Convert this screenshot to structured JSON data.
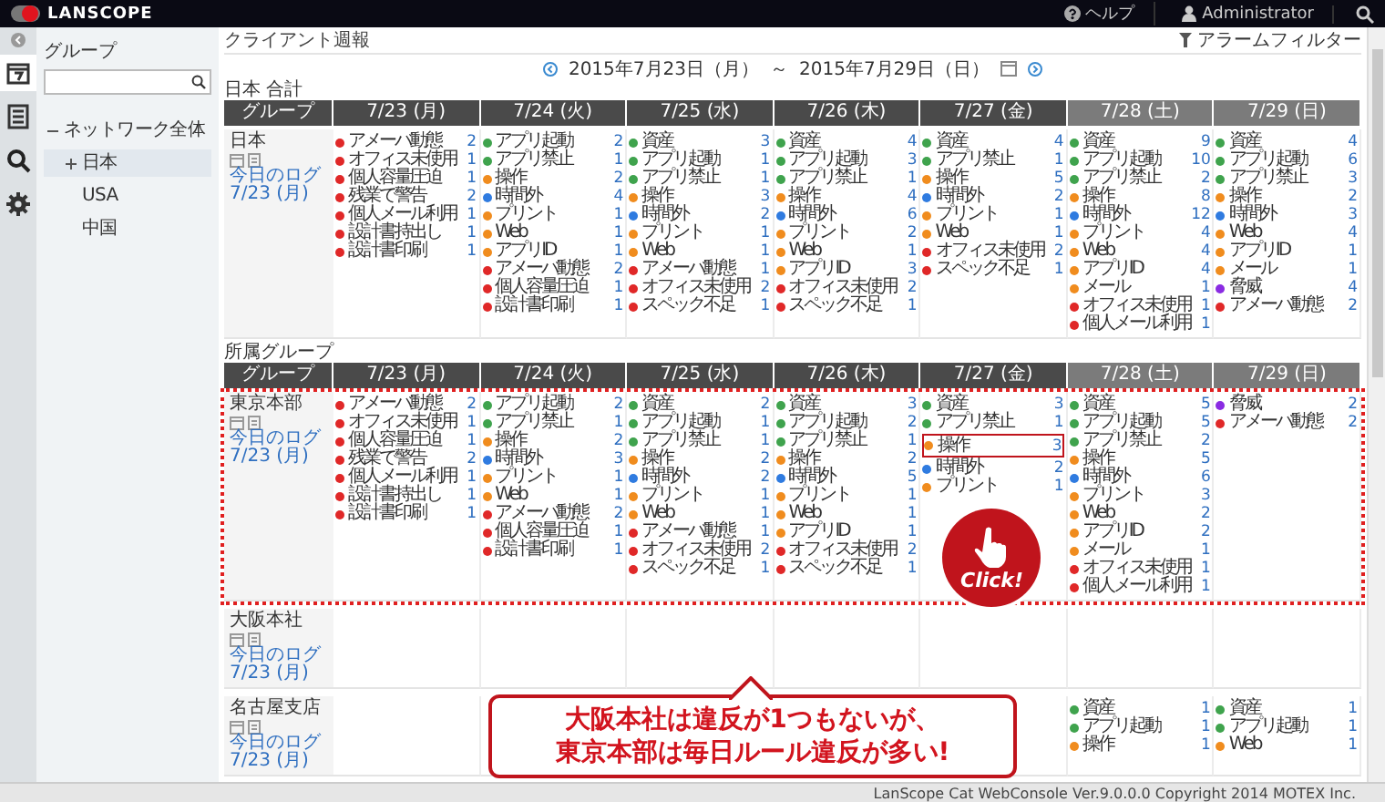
{
  "header": {
    "logo": "LANSCOPE",
    "help": "ヘルプ",
    "user": "Administrator"
  },
  "nav": [
    {
      "kind": "calendar",
      "selected": true
    },
    {
      "kind": "report",
      "selected": false
    },
    {
      "kind": "search",
      "selected": false
    },
    {
      "kind": "settings",
      "selected": false
    }
  ],
  "tree": {
    "title": "グループ",
    "nodes": [
      {
        "label": "ネットワーク全体",
        "expanded": true,
        "selected": false,
        "children": [
          {
            "label": "日本",
            "expanded": false,
            "selected": true
          },
          {
            "label": "USA",
            "selected": false
          },
          {
            "label": "中国",
            "selected": false
          }
        ]
      }
    ]
  },
  "page": {
    "title": "クライアント週報",
    "filter": "アラームフィルター",
    "date_from": "2015年7月23日（月）",
    "separator": "～",
    "date_to": "2015年7月29日（日）"
  },
  "tables": [
    {
      "label": "日本 合計",
      "group_header": "グループ",
      "columns": [
        {
          "label": "7/23 (月)",
          "weekend": false
        },
        {
          "label": "7/24 (火)",
          "weekend": false
        },
        {
          "label": "7/25 (水)",
          "weekend": false
        },
        {
          "label": "7/26 (木)",
          "weekend": false
        },
        {
          "label": "7/27 (金)",
          "weekend": false
        },
        {
          "label": "7/28 (土)",
          "weekend": true
        },
        {
          "label": "7/29 (日)",
          "weekend": true
        }
      ],
      "rows": [
        {
          "group": "日本",
          "log_link": "今日のログ 7/23 (月)",
          "highlighted": false,
          "cells": [
            [
              {
                "name": "アメーバ動態",
                "count": "2",
                "color": "#e02828"
              },
              {
                "name": "オフィス未使用",
                "count": "1",
                "color": "#e02828"
              },
              {
                "name": "個人容量圧迫",
                "count": "1",
                "color": "#e02828"
              },
              {
                "name": "残業で警告",
                "count": "2",
                "color": "#e02828"
              },
              {
                "name": "個人メール利用",
                "count": "1",
                "color": "#e02828"
              },
              {
                "name": "設計書持出し",
                "count": "1",
                "color": "#e02828"
              },
              {
                "name": "設計書印刷",
                "count": "1",
                "color": "#e02828"
              }
            ],
            [
              {
                "name": "アプリ起動",
                "count": "2",
                "color": "#3fa34d"
              },
              {
                "name": "アプリ禁止",
                "count": "1",
                "color": "#3fa34d"
              },
              {
                "name": "操作",
                "count": "2",
                "color": "#f08c1e"
              },
              {
                "name": "時間外",
                "count": "4",
                "color": "#2f7be0"
              },
              {
                "name": "プリント",
                "count": "1",
                "color": "#f08c1e"
              },
              {
                "name": "Web",
                "count": "1",
                "color": "#f08c1e"
              },
              {
                "name": "アプリID",
                "count": "1",
                "color": "#f08c1e"
              },
              {
                "name": "アメーバ動態",
                "count": "2",
                "color": "#e02828"
              },
              {
                "name": "個人容量圧迫",
                "count": "1",
                "color": "#e02828"
              },
              {
                "name": "設計書印刷",
                "count": "1",
                "color": "#e02828"
              }
            ],
            [
              {
                "name": "資産",
                "count": "3",
                "color": "#3fa34d"
              },
              {
                "name": "アプリ起動",
                "count": "1",
                "color": "#3fa34d"
              },
              {
                "name": "アプリ禁止",
                "count": "1",
                "color": "#3fa34d"
              },
              {
                "name": "操作",
                "count": "3",
                "color": "#f08c1e"
              },
              {
                "name": "時間外",
                "count": "2",
                "color": "#2f7be0"
              },
              {
                "name": "プリント",
                "count": "1",
                "color": "#f08c1e"
              },
              {
                "name": "Web",
                "count": "1",
                "color": "#f08c1e"
              },
              {
                "name": "アメーバ動態",
                "count": "1",
                "color": "#e02828"
              },
              {
                "name": "オフィス未使用",
                "count": "2",
                "color": "#e02828"
              },
              {
                "name": "スペック不足",
                "count": "1",
                "color": "#e02828"
              }
            ],
            [
              {
                "name": "資産",
                "count": "4",
                "color": "#3fa34d"
              },
              {
                "name": "アプリ起動",
                "count": "3",
                "color": "#3fa34d"
              },
              {
                "name": "アプリ禁止",
                "count": "1",
                "color": "#3fa34d"
              },
              {
                "name": "操作",
                "count": "4",
                "color": "#f08c1e"
              },
              {
                "name": "時間外",
                "count": "6",
                "color": "#2f7be0"
              },
              {
                "name": "プリント",
                "count": "2",
                "color": "#f08c1e"
              },
              {
                "name": "Web",
                "count": "1",
                "color": "#f08c1e"
              },
              {
                "name": "アプリID",
                "count": "3",
                "color": "#f08c1e"
              },
              {
                "name": "オフィス未使用",
                "count": "2",
                "color": "#e02828"
              },
              {
                "name": "スペック不足",
                "count": "1",
                "color": "#e02828"
              }
            ],
            [
              {
                "name": "資産",
                "count": "4",
                "color": "#3fa34d"
              },
              {
                "name": "アプリ禁止",
                "count": "1",
                "color": "#3fa34d"
              },
              {
                "name": "操作",
                "count": "5",
                "color": "#f08c1e"
              },
              {
                "name": "時間外",
                "count": "2",
                "color": "#2f7be0"
              },
              {
                "name": "プリント",
                "count": "1",
                "color": "#f08c1e"
              },
              {
                "name": "Web",
                "count": "1",
                "color": "#f08c1e"
              },
              {
                "name": "オフィス未使用",
                "count": "2",
                "color": "#e02828"
              },
              {
                "name": "スペック不足",
                "count": "1",
                "color": "#e02828"
              }
            ],
            [
              {
                "name": "資産",
                "count": "9",
                "color": "#3fa34d"
              },
              {
                "name": "アプリ起動",
                "count": "10",
                "color": "#3fa34d"
              },
              {
                "name": "アプリ禁止",
                "count": "2",
                "color": "#3fa34d"
              },
              {
                "name": "操作",
                "count": "8",
                "color": "#f08c1e"
              },
              {
                "name": "時間外",
                "count": "12",
                "color": "#2f7be0"
              },
              {
                "name": "プリント",
                "count": "4",
                "color": "#f08c1e"
              },
              {
                "name": "Web",
                "count": "4",
                "color": "#f08c1e"
              },
              {
                "name": "アプリID",
                "count": "4",
                "color": "#f08c1e"
              },
              {
                "name": "メール",
                "count": "1",
                "color": "#f08c1e"
              },
              {
                "name": "オフィス未使用",
                "count": "1",
                "color": "#e02828"
              },
              {
                "name": "個人メール利用",
                "count": "1",
                "color": "#e02828"
              }
            ],
            [
              {
                "name": "資産",
                "count": "4",
                "color": "#3fa34d"
              },
              {
                "name": "アプリ起動",
                "count": "6",
                "color": "#3fa34d"
              },
              {
                "name": "アプリ禁止",
                "count": "3",
                "color": "#3fa34d"
              },
              {
                "name": "操作",
                "count": "2",
                "color": "#f08c1e"
              },
              {
                "name": "時間外",
                "count": "3",
                "color": "#2f7be0"
              },
              {
                "name": "Web",
                "count": "4",
                "color": "#f08c1e"
              },
              {
                "name": "アプリID",
                "count": "1",
                "color": "#f08c1e"
              },
              {
                "name": "メール",
                "count": "1",
                "color": "#f08c1e"
              },
              {
                "name": "脅威",
                "count": "4",
                "color": "#8a2be2"
              },
              {
                "name": "アメーバ動態",
                "count": "2",
                "color": "#e02828"
              }
            ]
          ]
        }
      ]
    },
    {
      "label": "所属グループ",
      "group_header": "グループ",
      "columns": [
        {
          "label": "7/23 (月)",
          "weekend": false
        },
        {
          "label": "7/24 (火)",
          "weekend": false
        },
        {
          "label": "7/25 (水)",
          "weekend": false
        },
        {
          "label": "7/26 (木)",
          "weekend": false
        },
        {
          "label": "7/27 (金)",
          "weekend": false
        },
        {
          "label": "7/28 (土)",
          "weekend": true
        },
        {
          "label": "7/29 (日)",
          "weekend": true
        }
      ],
      "rows": [
        {
          "group": "東京本部",
          "log_link": "今日のログ 7/23 (月)",
          "highlighted": true,
          "cells": [
            [
              {
                "name": "アメーバ動態",
                "count": "2",
                "color": "#e02828"
              },
              {
                "name": "オフィス未使用",
                "count": "1",
                "color": "#e02828"
              },
              {
                "name": "個人容量圧迫",
                "count": "1",
                "color": "#e02828"
              },
              {
                "name": "残業で警告",
                "count": "2",
                "color": "#e02828"
              },
              {
                "name": "個人メール利用",
                "count": "1",
                "color": "#e02828"
              },
              {
                "name": "設計書持出し",
                "count": "1",
                "color": "#e02828"
              },
              {
                "name": "設計書印刷",
                "count": "1",
                "color": "#e02828"
              }
            ],
            [
              {
                "name": "アプリ起動",
                "count": "2",
                "color": "#3fa34d"
              },
              {
                "name": "アプリ禁止",
                "count": "1",
                "color": "#3fa34d"
              },
              {
                "name": "操作",
                "count": "2",
                "color": "#f08c1e"
              },
              {
                "name": "時間外",
                "count": "3",
                "color": "#2f7be0"
              },
              {
                "name": "プリント",
                "count": "1",
                "color": "#f08c1e"
              },
              {
                "name": "Web",
                "count": "1",
                "color": "#f08c1e"
              },
              {
                "name": "アメーバ動態",
                "count": "2",
                "color": "#e02828"
              },
              {
                "name": "個人容量圧迫",
                "count": "1",
                "color": "#e02828"
              },
              {
                "name": "設計書印刷",
                "count": "1",
                "color": "#e02828"
              }
            ],
            [
              {
                "name": "資産",
                "count": "2",
                "color": "#3fa34d"
              },
              {
                "name": "アプリ起動",
                "count": "1",
                "color": "#3fa34d"
              },
              {
                "name": "アプリ禁止",
                "count": "1",
                "color": "#3fa34d"
              },
              {
                "name": "操作",
                "count": "2",
                "color": "#f08c1e"
              },
              {
                "name": "時間外",
                "count": "2",
                "color": "#2f7be0"
              },
              {
                "name": "プリント",
                "count": "1",
                "color": "#f08c1e"
              },
              {
                "name": "Web",
                "count": "1",
                "color": "#f08c1e"
              },
              {
                "name": "アメーバ動態",
                "count": "1",
                "color": "#e02828"
              },
              {
                "name": "オフィス未使用",
                "count": "2",
                "color": "#e02828"
              },
              {
                "name": "スペック不足",
                "count": "1",
                "color": "#e02828"
              }
            ],
            [
              {
                "name": "資産",
                "count": "3",
                "color": "#3fa34d"
              },
              {
                "name": "アプリ起動",
                "count": "2",
                "color": "#3fa34d"
              },
              {
                "name": "アプリ禁止",
                "count": "1",
                "color": "#3fa34d"
              },
              {
                "name": "操作",
                "count": "2",
                "color": "#f08c1e"
              },
              {
                "name": "時間外",
                "count": "5",
                "color": "#2f7be0"
              },
              {
                "name": "プリント",
                "count": "1",
                "color": "#f08c1e"
              },
              {
                "name": "Web",
                "count": "1",
                "color": "#f08c1e"
              },
              {
                "name": "アプリID",
                "count": "1",
                "color": "#f08c1e"
              },
              {
                "name": "オフィス未使用",
                "count": "2",
                "color": "#e02828"
              },
              {
                "name": "スペック不足",
                "count": "1",
                "color": "#e02828"
              }
            ],
            [
              {
                "name": "資産",
                "count": "3",
                "color": "#3fa34d",
                "highlighted": false
              },
              {
                "name": "アプリ禁止",
                "count": "1",
                "color": "#3fa34d",
                "highlighted": false
              },
              {
                "name": "操作",
                "count": "3",
                "color": "#f08c1e",
                "highlighted": true
              },
              {
                "name": "時間外",
                "count": "2",
                "color": "#2f7be0",
                "highlighted": false
              },
              {
                "name": "プリント",
                "count": "1",
                "color": "#f08c1e",
                "highlighted": false
              }
            ],
            [
              {
                "name": "資産",
                "count": "5",
                "color": "#3fa34d"
              },
              {
                "name": "アプリ起動",
                "count": "5",
                "color": "#3fa34d"
              },
              {
                "name": "アプリ禁止",
                "count": "2",
                "color": "#3fa34d"
              },
              {
                "name": "操作",
                "count": "5",
                "color": "#f08c1e"
              },
              {
                "name": "時間外",
                "count": "6",
                "color": "#2f7be0"
              },
              {
                "name": "プリント",
                "count": "3",
                "color": "#f08c1e"
              },
              {
                "name": "Web",
                "count": "2",
                "color": "#f08c1e"
              },
              {
                "name": "アプリID",
                "count": "2",
                "color": "#f08c1e"
              },
              {
                "name": "メール",
                "count": "1",
                "color": "#f08c1e"
              },
              {
                "name": "オフィス未使用",
                "count": "1",
                "color": "#e02828"
              },
              {
                "name": "個人メール利用",
                "count": "1",
                "color": "#e02828"
              }
            ],
            [
              {
                "name": "脅威",
                "count": "2",
                "color": "#8a2be2"
              },
              {
                "name": "アメーバ動態",
                "count": "2",
                "color": "#e02828"
              }
            ]
          ]
        },
        {
          "group": "大阪本社",
          "log_link": "今日のログ 7/23 (月)",
          "highlighted": false,
          "cells": [
            [],
            [],
            [],
            [],
            [],
            [],
            []
          ]
        },
        {
          "group": "名古屋支店",
          "log_link": "今日のログ 7/23 (月)",
          "highlighted": false,
          "cells": [
            [],
            [],
            [],
            [],
            [],
            [
              {
                "name": "資産",
                "count": "1",
                "color": "#3fa34d"
              },
              {
                "name": "アプリ起動",
                "count": "1",
                "color": "#3fa34d"
              },
              {
                "name": "操作",
                "count": "1",
                "color": "#f08c1e"
              }
            ],
            [
              {
                "name": "資産",
                "count": "1",
                "color": "#3fa34d"
              },
              {
                "name": "アプリ起動",
                "count": "1",
                "color": "#3fa34d"
              },
              {
                "name": "Web",
                "count": "1",
                "color": "#f08c1e"
              }
            ]
          ]
        }
      ]
    }
  ],
  "click_badge": {
    "label": "Click!"
  },
  "callout": {
    "lines": [
      "大阪本社は違反が1つもないが、",
      "東京本部は毎日ルール違反が多い!"
    ]
  },
  "footer": "LanScope Cat WebConsole Ver.9.0.0.0 Copyright 2014 MOTEX Inc."
}
